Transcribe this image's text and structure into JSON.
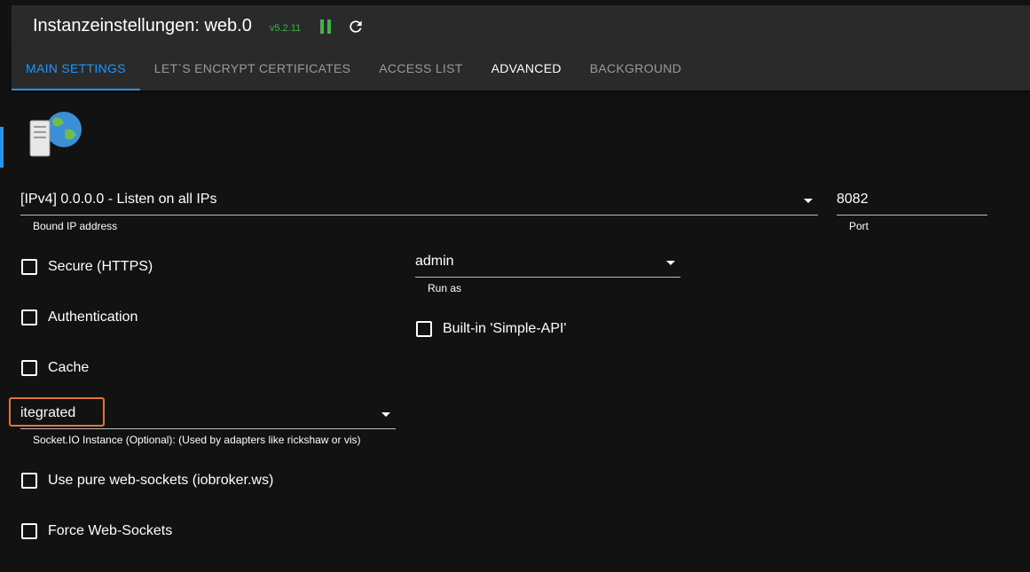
{
  "header": {
    "title": "Instanzeinstellungen: web.0",
    "version": "v5.2.11",
    "pause_icon": "pause-icon",
    "reload_icon": "reload-icon"
  },
  "tabs": [
    {
      "label": "MAIN SETTINGS",
      "active": true
    },
    {
      "label": "LET`S ENCRYPT CERTIFICATES",
      "active": false
    },
    {
      "label": "ACCESS LIST",
      "active": false
    },
    {
      "label": "ADVANCED",
      "active": false
    },
    {
      "label": "BACKGROUND",
      "active": false
    }
  ],
  "form": {
    "bind_ip": {
      "value": "[IPv4] 0.0.0.0 - Listen on all IPs",
      "helper": "Bound IP address"
    },
    "port": {
      "value": "8082",
      "helper": "Port"
    },
    "run_as": {
      "value": "admin",
      "helper": "Run as"
    },
    "secure": {
      "label": "Secure (HTTPS)",
      "checked": false
    },
    "authentication": {
      "label": "Authentication",
      "checked": false
    },
    "cache": {
      "label": "Cache",
      "checked": false
    },
    "simple_api": {
      "label": "Built-in 'Simple-API'",
      "checked": false
    },
    "socketio": {
      "value": "itegrated",
      "helper": "Socket.IO Instance (Optional): (Used by adapters like rickshaw or vis)"
    },
    "pure_ws": {
      "label": "Use pure web-sockets (iobroker.ws)",
      "checked": false
    },
    "force_ws": {
      "label": "Force Web-Sockets",
      "checked": false
    }
  },
  "colors": {
    "accent": "#2196f3",
    "version_green": "#3db34a",
    "highlight": "#e0763c",
    "background": "#121212",
    "header": "#2a2a2a"
  }
}
